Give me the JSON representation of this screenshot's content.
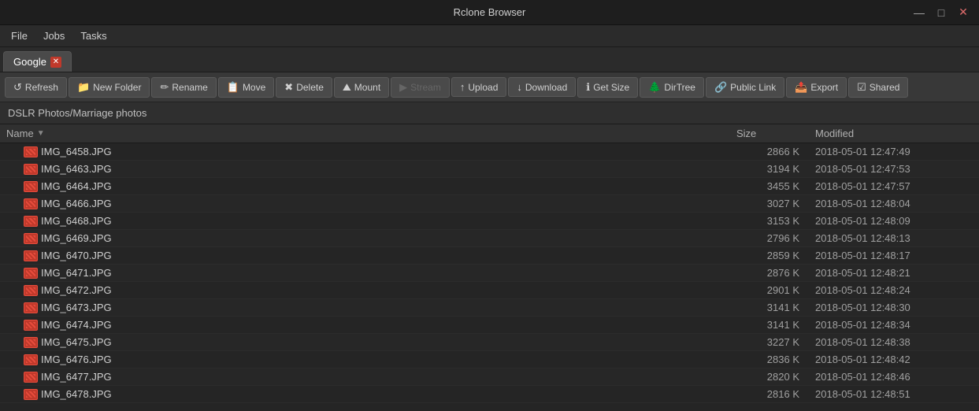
{
  "window": {
    "title": "Rclone Browser",
    "controls": {
      "minimize": "—",
      "maximize": "□",
      "close": "✕"
    }
  },
  "menu": {
    "items": [
      {
        "id": "file",
        "label": "File"
      },
      {
        "id": "jobs",
        "label": "Jobs"
      },
      {
        "id": "tasks",
        "label": "Tasks"
      }
    ]
  },
  "tabs": [
    {
      "id": "google",
      "label": "Google",
      "active": true,
      "closeable": true
    }
  ],
  "toolbar": {
    "buttons": [
      {
        "id": "refresh",
        "label": "Refresh",
        "icon": "↺",
        "disabled": false
      },
      {
        "id": "new-folder",
        "label": "New Folder",
        "icon": "📁",
        "disabled": false
      },
      {
        "id": "rename",
        "label": "Rename",
        "icon": "✏",
        "disabled": false
      },
      {
        "id": "move",
        "label": "Move",
        "icon": "📋",
        "disabled": false
      },
      {
        "id": "delete",
        "label": "Delete",
        "icon": "✖",
        "disabled": false
      },
      {
        "id": "mount",
        "label": "Mount",
        "icon": "⛰",
        "disabled": false
      },
      {
        "id": "stream",
        "label": "Stream",
        "icon": "▶",
        "disabled": true
      },
      {
        "id": "upload",
        "label": "Upload",
        "icon": "↑",
        "disabled": false
      },
      {
        "id": "download",
        "label": "Download",
        "icon": "↓",
        "disabled": false
      },
      {
        "id": "get-size",
        "label": "Get Size",
        "icon": "ℹ",
        "disabled": false
      },
      {
        "id": "dirtree",
        "label": "DirTree",
        "icon": "🌲",
        "disabled": false
      },
      {
        "id": "public-link",
        "label": "Public Link",
        "icon": "🔗",
        "disabled": false
      },
      {
        "id": "export",
        "label": "Export",
        "icon": "📤",
        "disabled": false
      },
      {
        "id": "shared",
        "label": "Shared",
        "icon": "☑",
        "disabled": false
      }
    ]
  },
  "breadcrumb": "DSLR Photos/Marriage photos",
  "file_list": {
    "columns": [
      {
        "id": "name",
        "label": "Name",
        "sortable": true
      },
      {
        "id": "size",
        "label": "Size"
      },
      {
        "id": "modified",
        "label": "Modified"
      }
    ],
    "files": [
      {
        "name": "IMG_6458.JPG",
        "size": "2866 K",
        "modified": "2018-05-01 12:47:49"
      },
      {
        "name": "IMG_6463.JPG",
        "size": "3194 K",
        "modified": "2018-05-01 12:47:53"
      },
      {
        "name": "IMG_6464.JPG",
        "size": "3455 K",
        "modified": "2018-05-01 12:47:57"
      },
      {
        "name": "IMG_6466.JPG",
        "size": "3027 K",
        "modified": "2018-05-01 12:48:04"
      },
      {
        "name": "IMG_6468.JPG",
        "size": "3153 K",
        "modified": "2018-05-01 12:48:09"
      },
      {
        "name": "IMG_6469.JPG",
        "size": "2796 K",
        "modified": "2018-05-01 12:48:13"
      },
      {
        "name": "IMG_6470.JPG",
        "size": "2859 K",
        "modified": "2018-05-01 12:48:17"
      },
      {
        "name": "IMG_6471.JPG",
        "size": "2876 K",
        "modified": "2018-05-01 12:48:21"
      },
      {
        "name": "IMG_6472.JPG",
        "size": "2901 K",
        "modified": "2018-05-01 12:48:24"
      },
      {
        "name": "IMG_6473.JPG",
        "size": "3141 K",
        "modified": "2018-05-01 12:48:30"
      },
      {
        "name": "IMG_6474.JPG",
        "size": "3141 K",
        "modified": "2018-05-01 12:48:34"
      },
      {
        "name": "IMG_6475.JPG",
        "size": "3227 K",
        "modified": "2018-05-01 12:48:38"
      },
      {
        "name": "IMG_6476.JPG",
        "size": "2836 K",
        "modified": "2018-05-01 12:48:42"
      },
      {
        "name": "IMG_6477.JPG",
        "size": "2820 K",
        "modified": "2018-05-01 12:48:46"
      },
      {
        "name": "IMG_6478.JPG",
        "size": "2816 K",
        "modified": "2018-05-01 12:48:51"
      }
    ]
  }
}
